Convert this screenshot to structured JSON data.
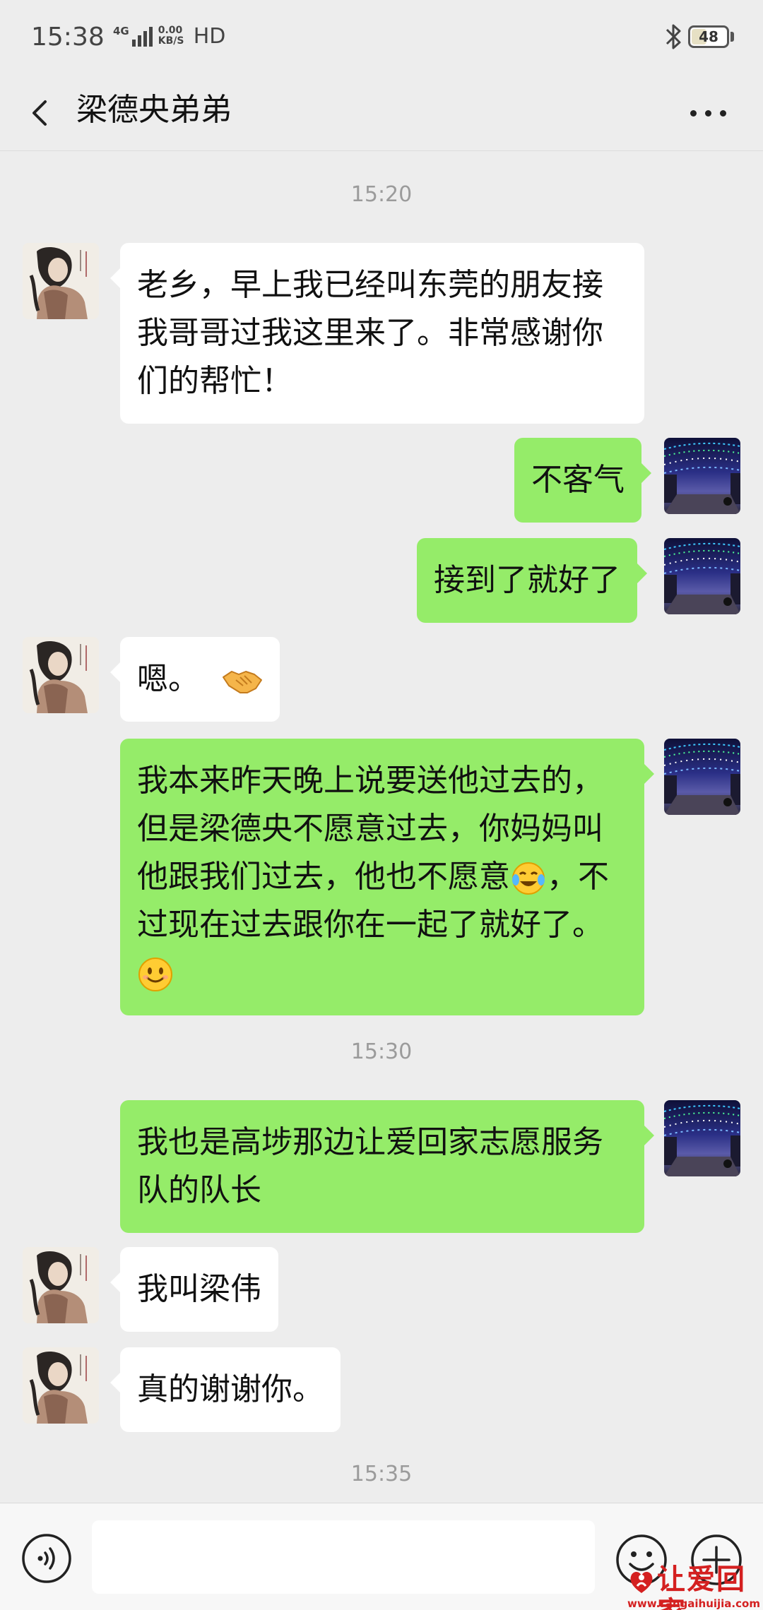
{
  "status_bar": {
    "time": "15:38",
    "network": "4G",
    "speed_value": "0.00",
    "speed_unit": "KB/S",
    "hd": "HD",
    "battery": "48",
    "battery_level": 0.48
  },
  "header": {
    "back_icon": "chevron-left-icon",
    "title": "梁德央弟弟",
    "more_icon": "more-dots-icon"
  },
  "messages": [
    {
      "type": "timestamp",
      "text": "15:20"
    },
    {
      "type": "incoming",
      "lines": [
        "老乡，早上我已经叫东莞的朋友接",
        "我哥哥过我这里来了。非常感谢你",
        "们的帮忙！"
      ]
    },
    {
      "type": "outgoing",
      "text": "不客气"
    },
    {
      "type": "outgoing",
      "text": "接到了就好了"
    },
    {
      "type": "incoming",
      "text": "嗯。",
      "emoji": "handshake-emoji"
    },
    {
      "type": "outgoing",
      "lines": [
        "我本来昨天晚上说要送他过去的，",
        "但是梁德央不愿意过去，你妈妈叫",
        "他跟我们过去，他也不愿意",
        "，不",
        "过现在过去跟你在一起了就好了。"
      ],
      "emojis": [
        "laughing-tears-emoji",
        "smile-emoji"
      ]
    },
    {
      "type": "timestamp",
      "text": "15:30"
    },
    {
      "type": "outgoing",
      "lines": [
        "我也是高埗那边让爱回家志愿服务",
        "队的队长"
      ]
    },
    {
      "type": "incoming",
      "text": "我叫梁伟"
    },
    {
      "type": "incoming",
      "text": "真的谢谢你。"
    },
    {
      "type": "timestamp",
      "text": "15:35"
    }
  ],
  "input_bar": {
    "voice_icon": "voice-icon",
    "input_value": "",
    "emoji_icon": "emoji-icon",
    "plus_icon": "plus-icon"
  },
  "watermark": {
    "name": "让爱回家",
    "url": "www.rangaihuijia.com"
  },
  "colors": {
    "background": "#ededed",
    "outgoing_bubble": "#95ec69",
    "incoming_bubble": "#ffffff",
    "watermark": "#d42020"
  }
}
